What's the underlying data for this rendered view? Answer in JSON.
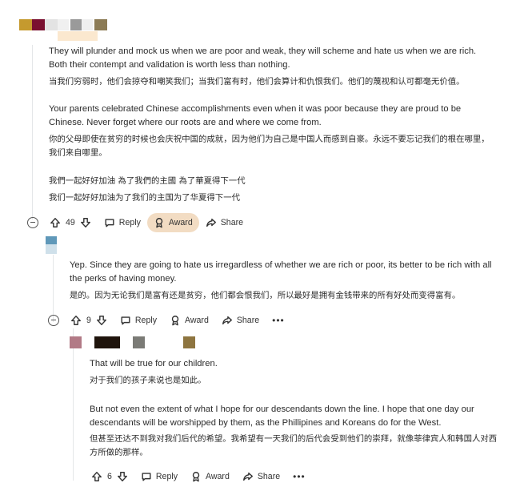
{
  "comments": [
    {
      "paragraphs_en": [
        "They will plunder and mock us when we are poor and weak, they will scheme and hate us when we are rich. Both their contempt and validation is worth less than nothing.",
        "Your parents celebrated Chinese accomplishments even when it was poor because they are proud to be Chinese. Never forget where our roots are and where we come from."
      ],
      "paragraphs_cn": [
        "当我们穷弱时，他们会掠夺和嘲笑我们；当我们富有时，他们会算计和仇恨我们。他们的蔑视和认可都毫无价值。",
        "你的父母即使在贫穷的时候也会庆祝中国的成就，因为他们为自己是中国人而感到自豪。永远不要忘记我们的根在哪里，我们来自哪里。"
      ],
      "slogan_trad": "我們一起好好加油 為了我們的主國 為了華夏得下一代",
      "slogan_simp": "我们一起好好加油为了我们的主国为了华夏得下一代",
      "votes": "49",
      "reply_label": "Reply",
      "award_label": "Award",
      "share_label": "Share"
    },
    {
      "en": "Yep. Since they are going to hate us irregardless of whether we are rich or poor, its better to be rich with all the perks of having money.",
      "cn": "是的。因为无论我们是富有还是贫穷，他们都会恨我们，所以最好是拥有金钱带来的所有好处而变得富有。",
      "votes": "9",
      "reply_label": "Reply",
      "award_label": "Award",
      "share_label": "Share",
      "more_label": "•••"
    },
    {
      "en1": "That will be true for our children.",
      "cn1": "对于我们的孩子来说也是如此。",
      "en2": "But not even the extent of what I hope for our descendants down the line. I hope that one day our descendants will be worshipped by them, as the Phillipines and Koreans do for the West.",
      "cn2": "但甚至还达不到我对我们后代的希望。我希望有一天我们的后代会受到他们的崇拜，就像菲律宾人和韩国人对西方所做的那样。",
      "votes": "6",
      "reply_label": "Reply",
      "award_label": "Award",
      "share_label": "Share",
      "more_label": "•••"
    }
  ],
  "colors": {
    "award_highlight": "#f2dcc3",
    "thread_line": "#e4e6e8",
    "text": "#2b2b2b"
  },
  "icons": [
    "upvote-icon",
    "downvote-icon",
    "reply-icon",
    "award-icon",
    "share-icon",
    "collapse-icon",
    "more-icon"
  ]
}
